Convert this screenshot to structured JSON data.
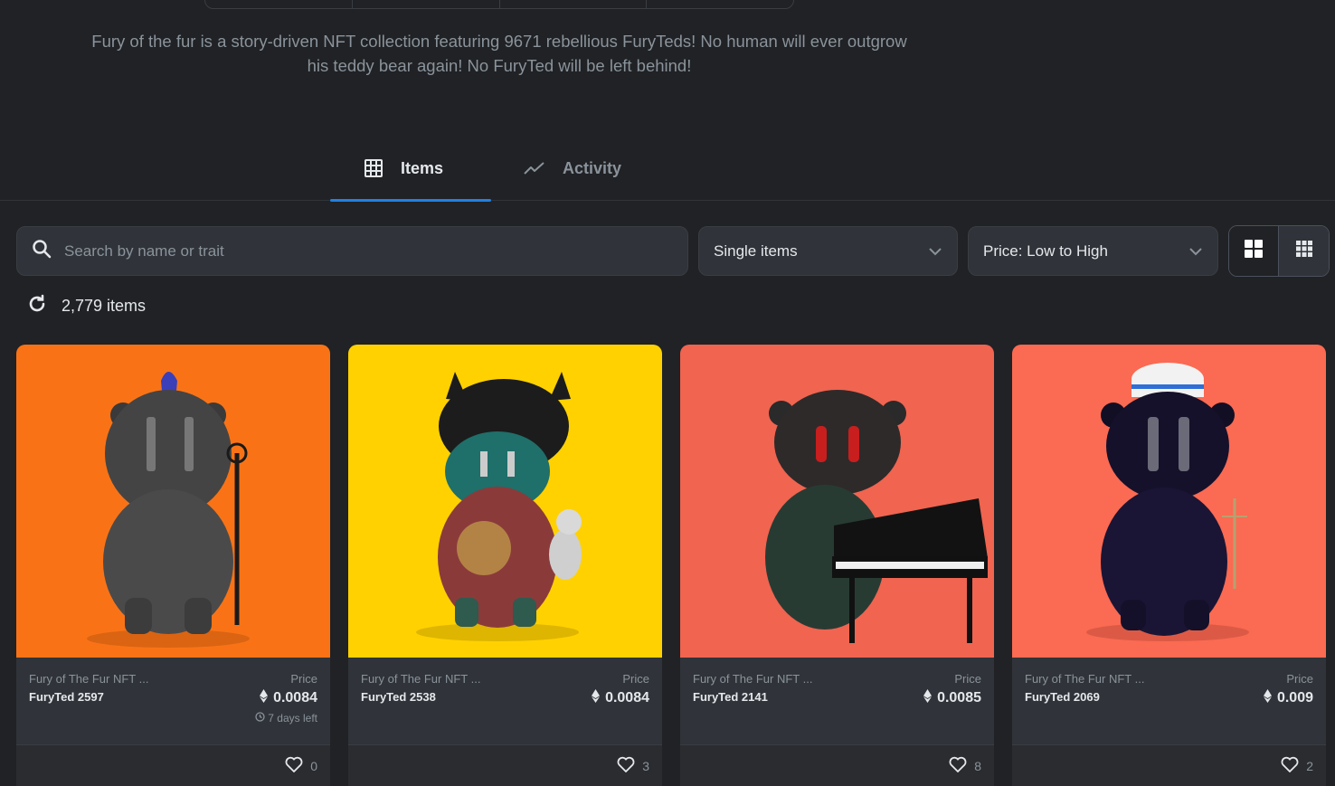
{
  "description": "Fury of the fur is a story-driven NFT collection featuring 9671 rebellious FuryTeds! No human will ever outgrow his teddy bear again! No FuryTed will be left behind!",
  "tabs": [
    {
      "label": "Items",
      "icon": "grid-icon",
      "active": true
    },
    {
      "label": "Activity",
      "icon": "trend-line-icon",
      "active": false
    }
  ],
  "search": {
    "placeholder": "Search by name or trait",
    "value": ""
  },
  "filters": {
    "item_type": "Single items",
    "sort": "Price: Low to High"
  },
  "view_toggle": {
    "active": "large-grid",
    "options": [
      "large-grid",
      "small-grid"
    ]
  },
  "results": {
    "count_label": "2,779 items"
  },
  "colors": {
    "background": "#202225",
    "surface": "#303339",
    "accent": "#2081e2",
    "muted_text": "#8a939b"
  },
  "cards": [
    {
      "collection": "Fury of The Fur NFT ...",
      "name": "FuryTed 2597",
      "price_label": "Price",
      "price": "0.0084",
      "time_left": "7 days left",
      "likes": "0",
      "bg": "#f97316",
      "accent": "#3b3fb8"
    },
    {
      "collection": "Fury of The Fur NFT ...",
      "name": "FuryTed 2538",
      "price_label": "Price",
      "price": "0.0084",
      "time_left": "",
      "likes": "3",
      "bg": "#ffd100",
      "accent": "#1c1c1c"
    },
    {
      "collection": "Fury of The Fur NFT ...",
      "name": "FuryTed 2141",
      "price_label": "Price",
      "price": "0.0085",
      "time_left": "",
      "likes": "8",
      "bg": "#f06450",
      "accent": "#2a2a2a"
    },
    {
      "collection": "Fury of The Fur NFT ...",
      "name": "FuryTed 2069",
      "price_label": "Price",
      "price": "0.009",
      "time_left": "",
      "likes": "2",
      "bg": "#fb6a52",
      "accent": "#1a1530"
    }
  ]
}
